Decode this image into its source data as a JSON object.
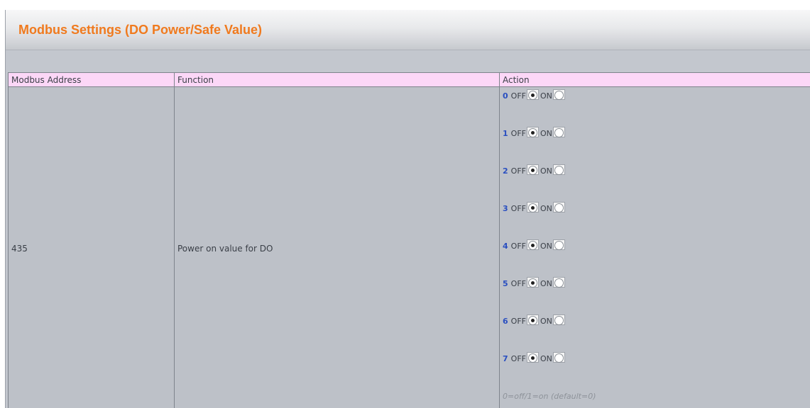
{
  "header": {
    "title": "Modbus Settings (DO Power/Safe Value)"
  },
  "table": {
    "columns": [
      "Modbus Address",
      "Function",
      "Action"
    ],
    "row": {
      "address": "435",
      "function": "Power on value for DO"
    },
    "action": {
      "off_label": "OFF",
      "on_label": "ON",
      "bits": [
        {
          "bit": "0",
          "selected": "OFF"
        },
        {
          "bit": "1",
          "selected": "OFF"
        },
        {
          "bit": "2",
          "selected": "OFF"
        },
        {
          "bit": "3",
          "selected": "OFF"
        },
        {
          "bit": "4",
          "selected": "OFF"
        },
        {
          "bit": "5",
          "selected": "OFF"
        },
        {
          "bit": "6",
          "selected": "OFF"
        },
        {
          "bit": "7",
          "selected": "OFF"
        }
      ],
      "hint": "0=off/1=on (default=0)"
    }
  },
  "colors": {
    "title": "#f07a1e",
    "header_row": "#fcd7f7",
    "cell_bg": "#bdc1c8",
    "bit_number": "#2a4fc0"
  }
}
